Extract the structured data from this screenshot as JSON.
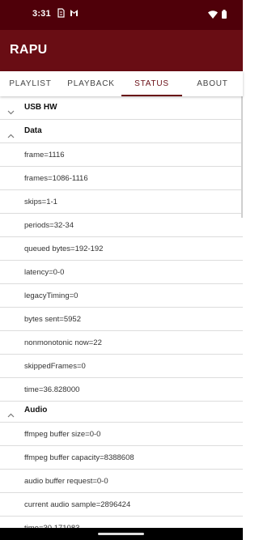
{
  "status_bar": {
    "time": "3:31",
    "icons": [
      "sim-card-icon",
      "gmail-icon"
    ],
    "right_icons": [
      "wifi-icon",
      "battery-icon"
    ]
  },
  "app": {
    "title": "RAPU"
  },
  "tabs": [
    {
      "label": "PLAYLIST",
      "active": false
    },
    {
      "label": "PLAYBACK",
      "active": false
    },
    {
      "label": "STATUS",
      "active": true
    },
    {
      "label": "ABOUT",
      "active": false
    }
  ],
  "groups": [
    {
      "title": "USB HW",
      "expanded": false,
      "items": []
    },
    {
      "title": "Data",
      "expanded": true,
      "items": [
        "frame=1116",
        "frames=1086-1116",
        "skips=1-1",
        "periods=32-34",
        "queued bytes=192-192",
        "latency=0-0",
        "legacyTiming=0",
        "bytes sent=5952",
        "nonmonotonic now=22",
        "skippedFrames=0",
        "time=36.828000"
      ]
    },
    {
      "title": "Audio",
      "expanded": true,
      "items": [
        "ffmpeg buffer size=0-0",
        "ffmpeg buffer capacity=8388608",
        "audio buffer request=0-0",
        "current audio sample=2896424",
        "time=30.171083"
      ]
    }
  ],
  "colors": {
    "status_bar": "#4f0009",
    "app_bar": "#690d14",
    "accent": "#690d14"
  }
}
